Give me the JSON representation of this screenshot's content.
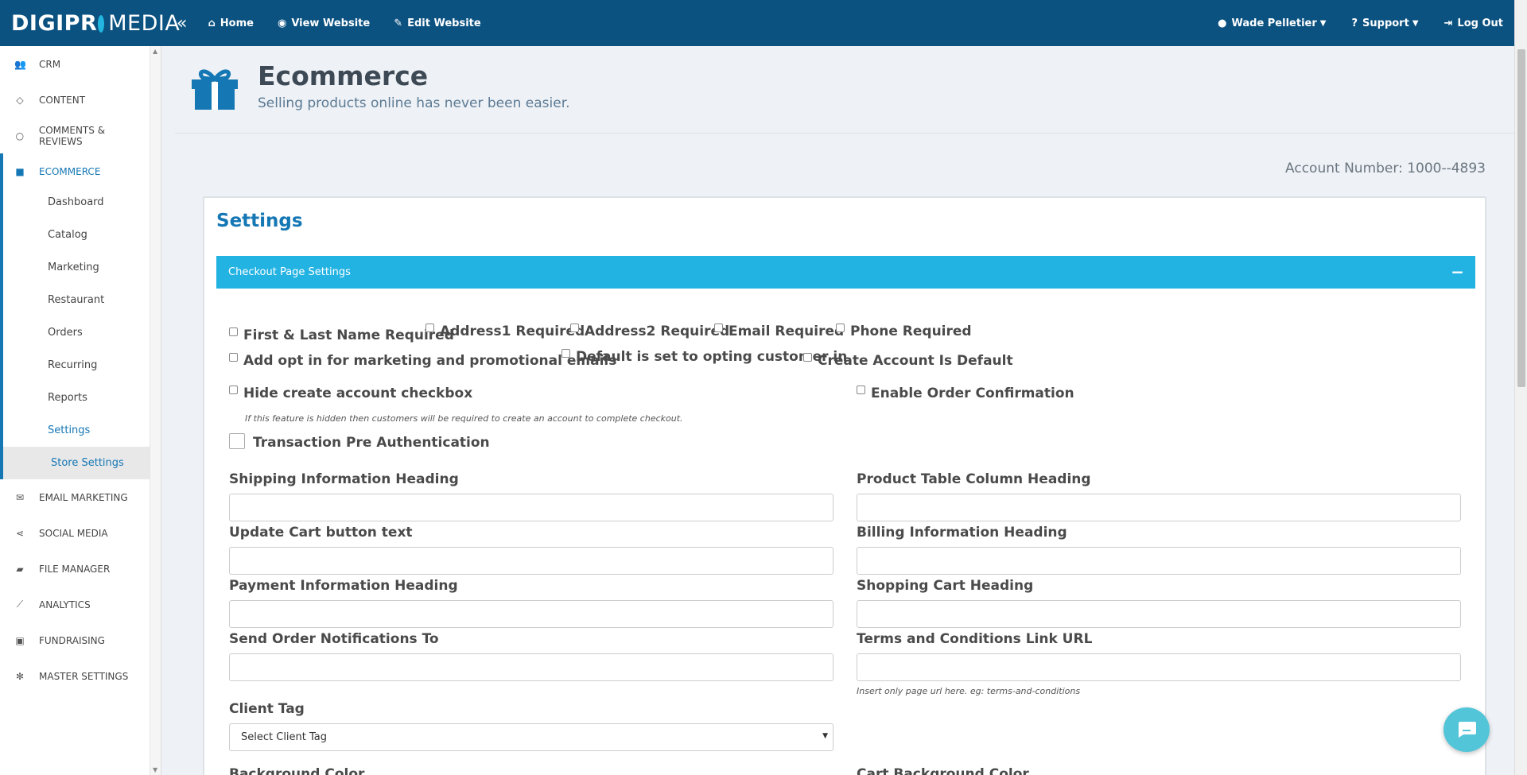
{
  "brand": {
    "part1": "DIGI",
    "part2": "PR",
    "part3": "MEDIA"
  },
  "topnav": {
    "home": "Home",
    "view_website": "View Website",
    "edit_website": "Edit Website",
    "user": "Wade Pelletier",
    "support": "Support",
    "logout": "Log Out"
  },
  "sidebar": {
    "items": [
      {
        "label": "CRM",
        "icon": "users-icon"
      },
      {
        "label": "CONTENT",
        "icon": "diamond-icon"
      },
      {
        "label": "COMMENTS & REVIEWS",
        "icon": "comment-icon"
      },
      {
        "label": "ECOMMERCE",
        "icon": "gift-icon"
      },
      {
        "label": "EMAIL MARKETING",
        "icon": "envelope-icon"
      },
      {
        "label": "SOCIAL MEDIA",
        "icon": "share-icon"
      },
      {
        "label": "FILE MANAGER",
        "icon": "folder-icon"
      },
      {
        "label": "ANALYTICS",
        "icon": "line-chart-icon"
      },
      {
        "label": "FUNDRAISING",
        "icon": "money-icon"
      },
      {
        "label": "MASTER SETTINGS",
        "icon": "gear-icon"
      }
    ],
    "sub": [
      "Dashboard",
      "Catalog",
      "Marketing",
      "Restaurant",
      "Orders",
      "Recurring",
      "Reports",
      "Settings",
      "Store Settings"
    ]
  },
  "header": {
    "title": "Ecommerce",
    "subtitle": "Selling products online has never been easier."
  },
  "account": "Account Number: 1000--4893",
  "settings": {
    "title": "Settings",
    "panel": "Checkout Page Settings",
    "checkboxes": {
      "name_required": "First & Last Name Required",
      "address1": "Address1 Required",
      "address2": "Address2 Required",
      "email": "Email Required",
      "phone": "Phone Required",
      "opt_in": "Add opt in for marketing and promotional emails",
      "default_opt": "Default is set to opting customer in",
      "create_account": "Create Account Is Default",
      "hide_create": "Hide create account checkbox",
      "order_confirm": "Enable Order Confirmation",
      "pre_auth": "Transaction Pre Authentication"
    },
    "hide_note": "If this feature is hidden then customers will be required to create an account to complete checkout.",
    "fields": {
      "shipping_heading": "Shipping Information Heading",
      "product_table": "Product Table Column Heading",
      "update_cart": "Update Cart button text",
      "billing_heading": "Billing Information Heading",
      "payment_heading": "Payment Information Heading",
      "shopping_cart": "Shopping Cart Heading",
      "order_notify": "Send Order Notifications To",
      "terms_url": "Terms and Conditions Link URL",
      "client_tag": "Client Tag",
      "background_color": "Background Color",
      "cart_background_color": "Cart Background Color"
    },
    "terms_note": "Insert only page url here. eg: terms-and-conditions",
    "client_tag_value": "Select Client Tag"
  }
}
